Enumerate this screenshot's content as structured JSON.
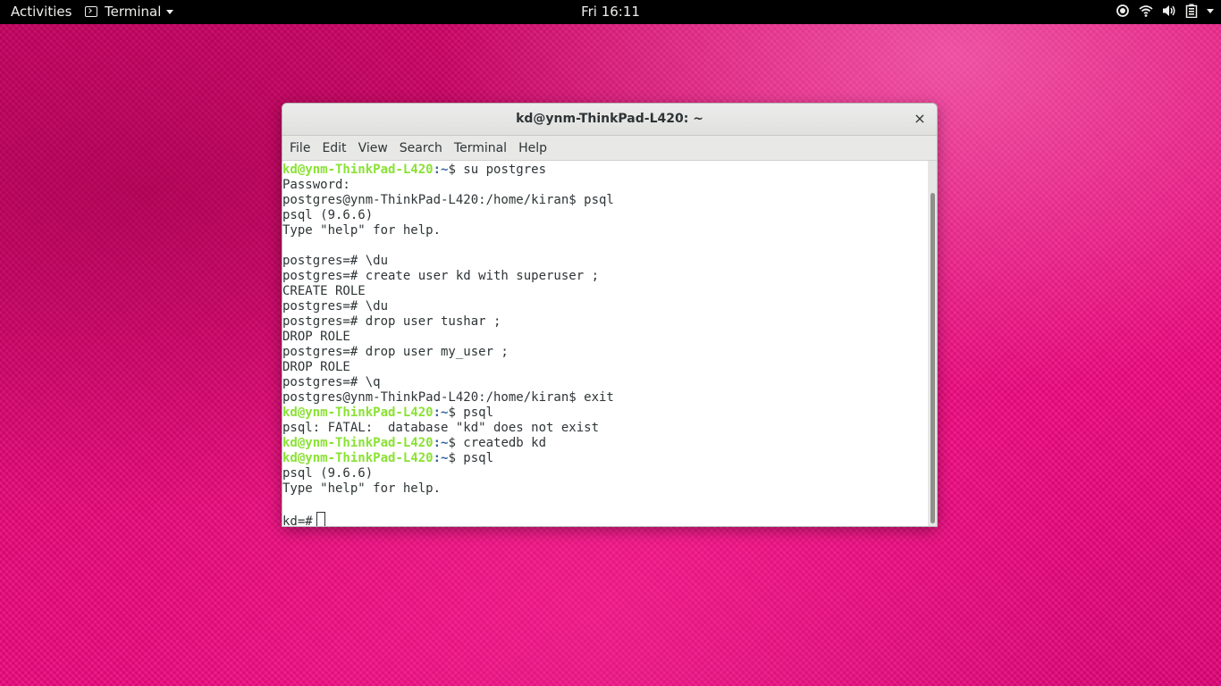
{
  "topbar": {
    "activities": "Activities",
    "app_name": "Terminal",
    "clock": "Fri 16:11",
    "tray_icons": [
      "location-icon",
      "wifi-icon",
      "volume-icon",
      "battery-icon"
    ]
  },
  "window": {
    "title": "kd@ynm-ThinkPad-L420: ~",
    "close_glyph": "×",
    "menu": [
      "File",
      "Edit",
      "View",
      "Search",
      "Terminal",
      "Help"
    ],
    "terminal": {
      "lines": [
        {
          "user": "kd@ynm-ThinkPad-L420",
          "path": ":~",
          "text": "$ su postgres"
        },
        {
          "text": "Password:"
        },
        {
          "text": "postgres@ynm-ThinkPad-L420:/home/kiran$ psql"
        },
        {
          "text": "psql (9.6.6)"
        },
        {
          "text": "Type \"help\" for help."
        },
        {
          "text": ""
        },
        {
          "text": "postgres=# \\du"
        },
        {
          "text": "postgres=# create user kd with superuser ;"
        },
        {
          "text": "CREATE ROLE"
        },
        {
          "text": "postgres=# \\du"
        },
        {
          "text": "postgres=# drop user tushar ;"
        },
        {
          "text": "DROP ROLE"
        },
        {
          "text": "postgres=# drop user my_user ;"
        },
        {
          "text": "DROP ROLE"
        },
        {
          "text": "postgres=# \\q"
        },
        {
          "text": "postgres@ynm-ThinkPad-L420:/home/kiran$ exit"
        },
        {
          "user": "kd@ynm-ThinkPad-L420",
          "path": ":~",
          "text": "$ psql"
        },
        {
          "text": "psql: FATAL:  database \"kd\" does not exist"
        },
        {
          "user": "kd@ynm-ThinkPad-L420",
          "path": ":~",
          "text": "$ createdb kd"
        },
        {
          "user": "kd@ynm-ThinkPad-L420",
          "path": ":~",
          "text": "$ psql"
        },
        {
          "text": "psql (9.6.6)"
        },
        {
          "text": "Type \"help\" for help."
        },
        {
          "text": ""
        },
        {
          "text": "kd=#",
          "cursor": true
        }
      ]
    }
  },
  "colors": {
    "prompt_user": "#8ae234",
    "prompt_path": "#3465a4",
    "text": "#2e3436",
    "desktop_accent": "#e8097a"
  }
}
